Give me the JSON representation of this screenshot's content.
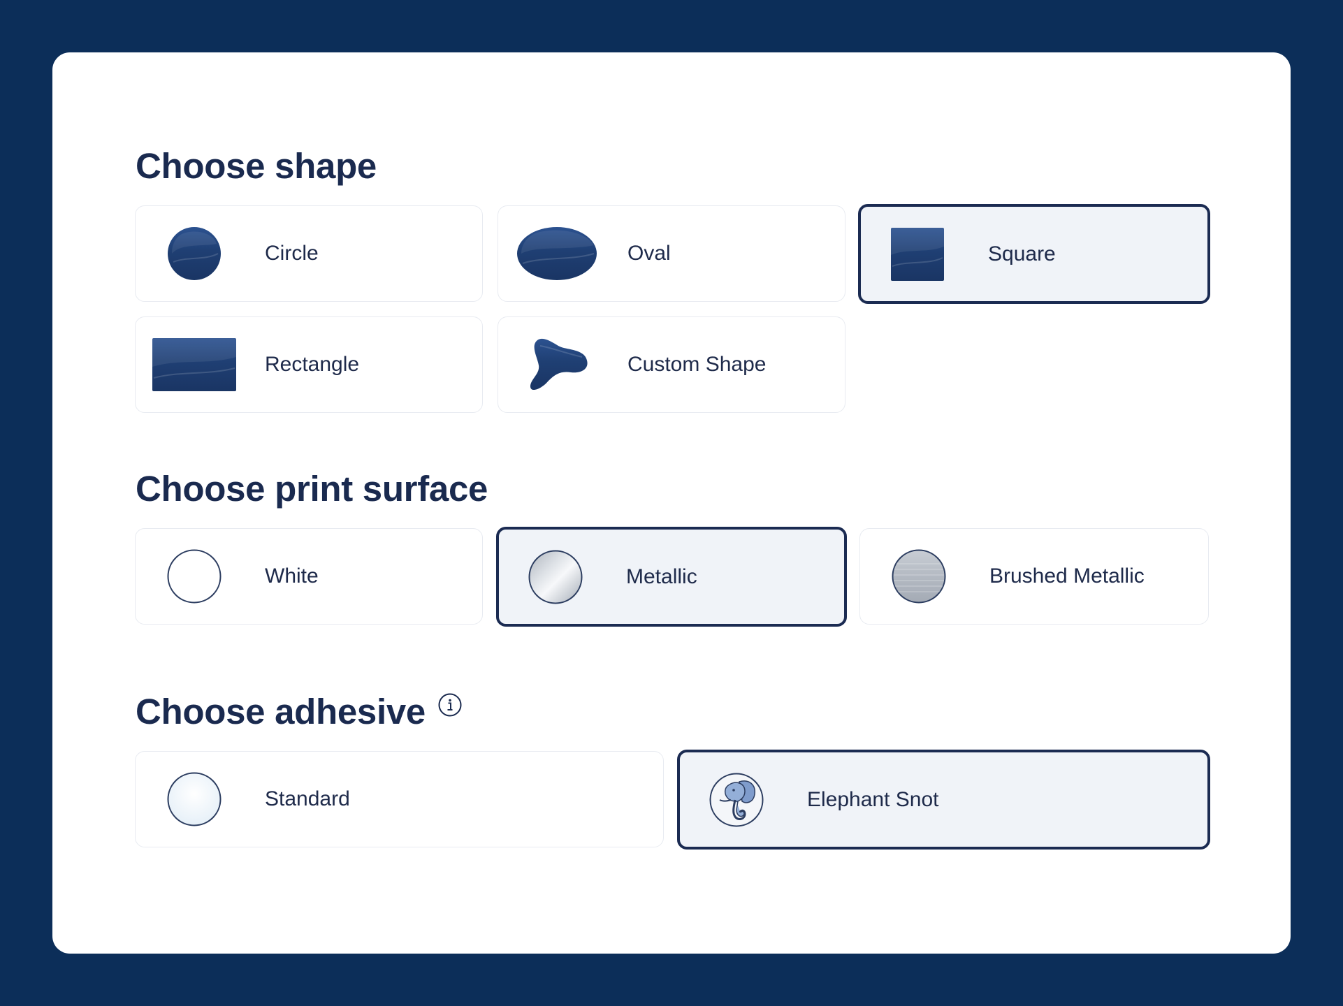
{
  "shape_section": {
    "title": "Choose shape",
    "options": [
      {
        "label": "Circle",
        "icon": "circle-shape-icon",
        "selected": false
      },
      {
        "label": "Oval",
        "icon": "oval-shape-icon",
        "selected": false
      },
      {
        "label": "Square",
        "icon": "square-shape-icon",
        "selected": true
      },
      {
        "label": "Rectangle",
        "icon": "rectangle-shape-icon",
        "selected": false
      },
      {
        "label": "Custom Shape",
        "icon": "custom-shape-icon",
        "selected": false
      }
    ]
  },
  "surface_section": {
    "title": "Choose print surface",
    "options": [
      {
        "label": "White",
        "icon": "white-surface-icon",
        "selected": false
      },
      {
        "label": "Metallic",
        "icon": "metallic-surface-icon",
        "selected": true
      },
      {
        "label": "Brushed Metallic",
        "icon": "brushed-metallic-surface-icon",
        "selected": false
      }
    ]
  },
  "adhesive_section": {
    "title": "Choose adhesive",
    "info_icon": "info-icon",
    "options": [
      {
        "label": "Standard",
        "icon": "standard-adhesive-icon",
        "selected": false
      },
      {
        "label": "Elephant Snot",
        "icon": "elephant-icon",
        "selected": true
      }
    ]
  },
  "colors": {
    "background": "#0c2e59",
    "card": "#ffffff",
    "text": "#1a2a4f",
    "selected_border": "#1b2b52",
    "selected_fill": "#f0f3f8",
    "shape_fill": "#1f3f73"
  }
}
